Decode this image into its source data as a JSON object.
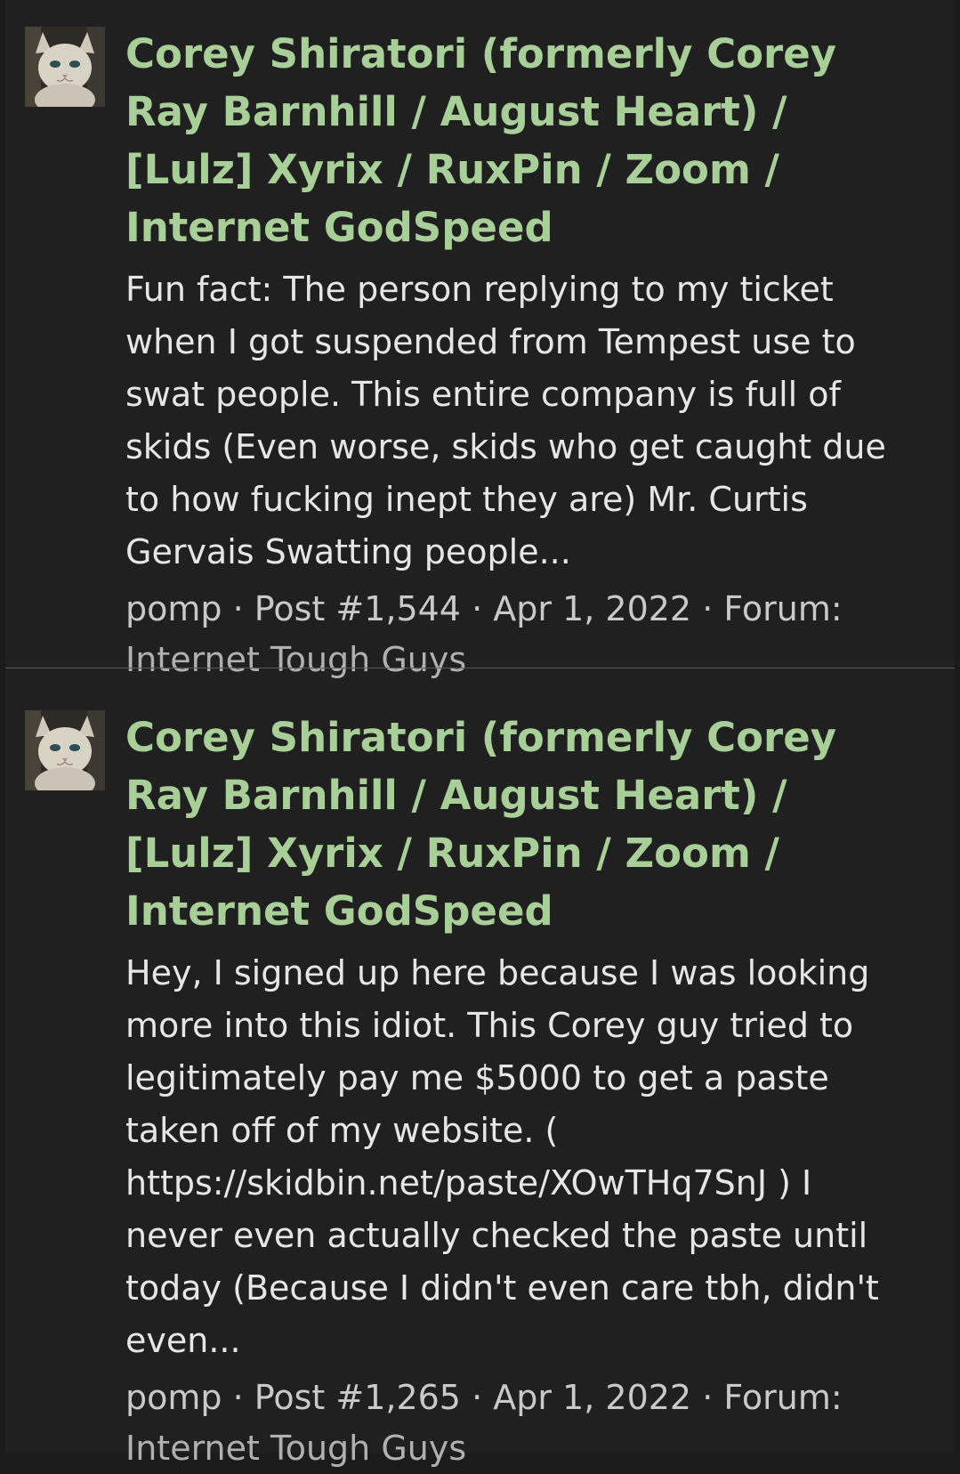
{
  "results": [
    {
      "title": "Corey Shiratori (formerly Corey Ray Barnhill / August Heart) / [Lulz] Xyrix / RuxPin / Zoom / Internet GodSpeed",
      "snippet": "Fun fact: The person replying to my ticket when I got suspended from Tempest use to swat people. This entire company is full of skids (Even worse, skids who get caught due to how fucking inept they are) Mr. Curtis Gervais Swatting people...",
      "author": "pomp",
      "post": "Post #1,544",
      "date": "Apr 1, 2022",
      "forum_label": "Forum:",
      "forum": "Internet Tough Guys"
    },
    {
      "title": "Corey Shiratori (formerly Corey Ray Barnhill / August Heart) / [Lulz] Xyrix / RuxPin / Zoom / Internet GodSpeed",
      "snippet": "Hey, I signed up here because I was looking more into this idiot. This Corey guy tried to legitimately pay me $5000 to get a paste taken off of my website. ( https://skidbin.net/paste/XOwTHq7SnJ ) I never even actually checked the paste until today (Because I didn't even care tbh, didn't even...",
      "author": "pomp",
      "post": "Post #1,265",
      "date": "Apr 1, 2022",
      "forum_label": "Forum:",
      "forum": "Internet Tough Guys"
    }
  ],
  "separator": " · ",
  "colors": {
    "background": "#1b1b1b",
    "panel": "#202020",
    "title": "#a8cf97",
    "snippet": "#e6e6e6",
    "meta": "#c9c9c9",
    "divider": "#5a5a5a"
  },
  "icons": {
    "avatar": "cat-avatar-icon"
  }
}
